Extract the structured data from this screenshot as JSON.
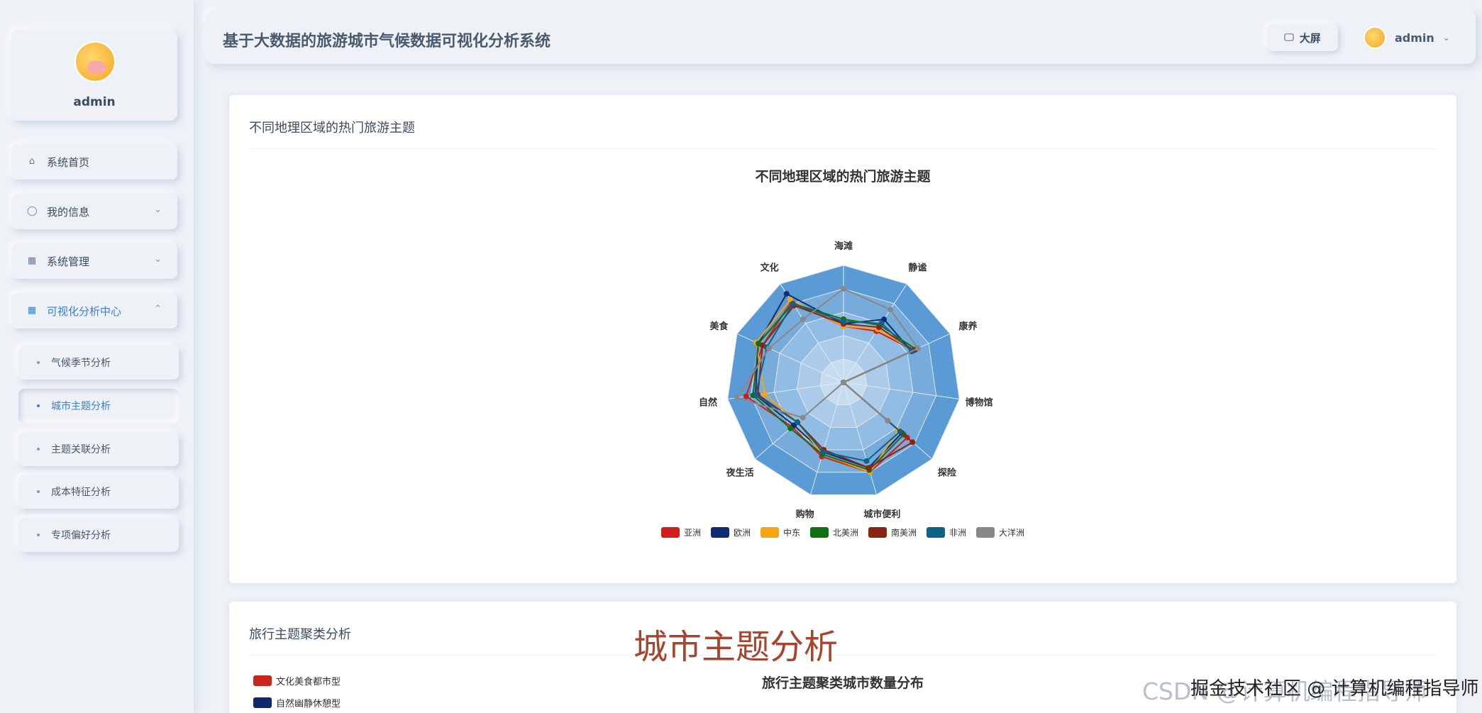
{
  "sidebar": {
    "profile_name": "admin",
    "menu": [
      {
        "label": "系统首页",
        "icon": "home-icon"
      },
      {
        "label": "我的信息",
        "icon": "user-icon"
      },
      {
        "label": "系统管理",
        "icon": "grid-icon"
      },
      {
        "label": "可视化分析中心",
        "icon": "grid-icon"
      }
    ],
    "submenu": [
      {
        "label": "气候季节分析"
      },
      {
        "label": "城市主题分析"
      },
      {
        "label": "主题关联分析"
      },
      {
        "label": "成本特征分析"
      },
      {
        "label": "专项偏好分析"
      }
    ]
  },
  "header": {
    "title": "基于大数据的旅游城市气候数据可视化分析系统",
    "big_screen_label": "大屏",
    "user_name": "admin"
  },
  "card1": {
    "title": "不同地理区域的热门旅游主题"
  },
  "card2": {
    "title": "旅行主题聚类分析",
    "legend": [
      {
        "name": "文化美食都市型",
        "color": "#c9261c"
      },
      {
        "name": "自然幽静休憩型",
        "color": "#0f2a6b"
      }
    ]
  },
  "chart_data": [
    {
      "type": "radar",
      "title": "不同地理区域的热门旅游主题",
      "indicators": [
        "海滩",
        "静谧",
        "康养",
        "博物馆",
        "探险",
        "城市便利",
        "购物",
        "夜生活",
        "自然",
        "美食",
        "文化"
      ],
      "max": 5,
      "series": [
        {
          "name": "亚洲",
          "color": "#d21e1b",
          "values": [
            2.4,
            2.6,
            3.3,
            0.0,
            3.6,
            4.0,
            3.3,
            2.9,
            4.2,
            3.8,
            4.1
          ]
        },
        {
          "name": "欧洲",
          "color": "#0e2d70",
          "values": [
            2.5,
            3.2,
            3.2,
            0.0,
            3.3,
            3.8,
            3.1,
            2.8,
            3.8,
            4.0,
            4.5
          ]
        },
        {
          "name": "中东",
          "color": "#f5a414",
          "values": [
            2.4,
            2.7,
            3.3,
            0.0,
            3.1,
            4.0,
            3.2,
            2.6,
            3.4,
            4.1,
            4.2
          ]
        },
        {
          "name": "北美洲",
          "color": "#136f14",
          "values": [
            2.7,
            2.9,
            3.4,
            0.0,
            3.4,
            3.9,
            3.2,
            3.0,
            3.9,
            4.0,
            4.0
          ]
        },
        {
          "name": "南美洲",
          "color": "#8c2412",
          "values": [
            2.5,
            2.8,
            3.3,
            0.0,
            3.9,
            3.8,
            3.0,
            2.6,
            3.7,
            3.8,
            3.9
          ]
        },
        {
          "name": "非洲",
          "color": "#0d6285",
          "values": [
            2.6,
            3.0,
            3.2,
            0.0,
            3.2,
            3.5,
            3.1,
            2.6,
            3.8,
            3.6,
            4.0
          ]
        },
        {
          "name": "大洋洲",
          "color": "#888888",
          "values": [
            4.0,
            3.7,
            3.5,
            0.0,
            2.5,
            0.0,
            0.0,
            2.3,
            4.6,
            3.5,
            3.2
          ]
        }
      ],
      "legend_position": "bottom-center"
    },
    {
      "type": "other",
      "title": "旅行主题聚类城市数量分布",
      "legend": [
        "文化美食都市型",
        "自然幽静休憩型"
      ]
    }
  ],
  "overlay": {
    "caption": "城市主题分析",
    "watermark": "CSDN @计算机编程指导师",
    "watermark_over": "掘金技术社区 @ 计算机编程指导师"
  }
}
